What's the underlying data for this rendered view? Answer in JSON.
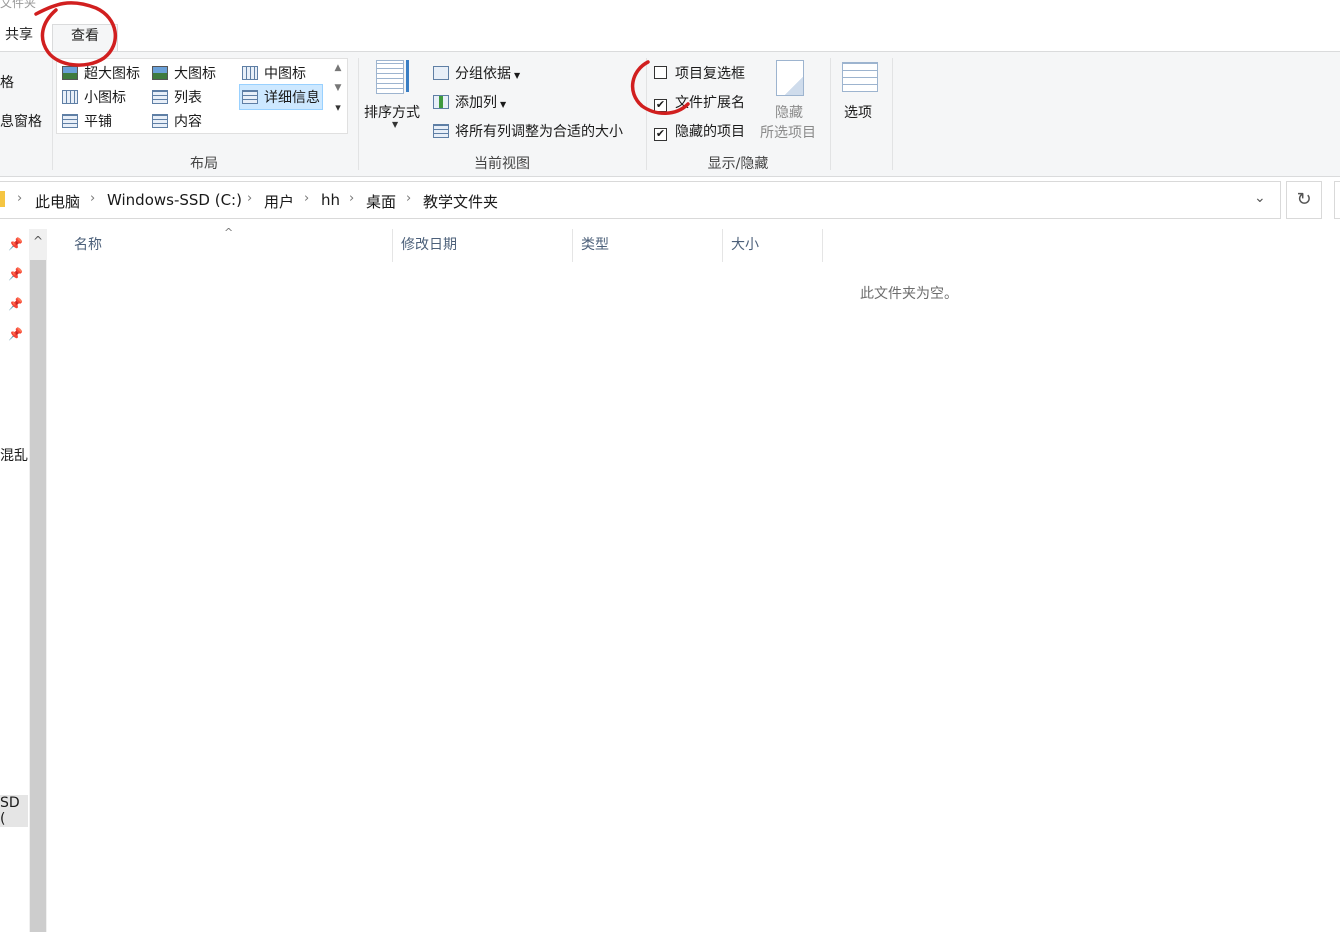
{
  "window": {
    "title_fragment": "文件夹"
  },
  "tabs": [
    {
      "label": "共享"
    },
    {
      "label": "查看"
    }
  ],
  "ribbon": {
    "left_fragments": {
      "nav_pane": "格",
      "preview_pane": "息窗格"
    },
    "layout": {
      "group_label": "布局",
      "items": {
        "extra_large": "超大图标",
        "large": "大图标",
        "medium": "中图标",
        "small": "小图标",
        "list": "列表",
        "details": "详细信息",
        "tiles": "平铺",
        "content": "内容"
      }
    },
    "current_view": {
      "group_label": "当前视图",
      "sort_by": "排序方式",
      "group_by": "分组依据",
      "add_columns": "添加列",
      "size_all_columns": "将所有列调整为合适的大小"
    },
    "show_hide": {
      "group_label": "显示/隐藏",
      "item_checkboxes": {
        "label": "项目复选框",
        "checked": false
      },
      "file_extensions": {
        "label": "文件扩展名",
        "checked": true
      },
      "hidden_items": {
        "label": "隐藏的项目",
        "checked": true
      },
      "hide_selected_line1": "隐藏",
      "hide_selected_line2": "所选项目"
    },
    "options": {
      "label": "选项"
    }
  },
  "address": {
    "crumbs": [
      "此电脑",
      "Windows-SSD (C:)",
      "用户",
      "hh",
      "桌面",
      "教学文件夹"
    ]
  },
  "nav": {
    "fragment_mid": "混乱",
    "fragment_bottom": "SD ("
  },
  "columns": [
    "名称",
    "修改日期",
    "类型",
    "大小"
  ],
  "content": {
    "empty_message": "此文件夹为空。"
  },
  "colors": {
    "annotation": "#d11f1f",
    "selection": "#cde8ff"
  }
}
